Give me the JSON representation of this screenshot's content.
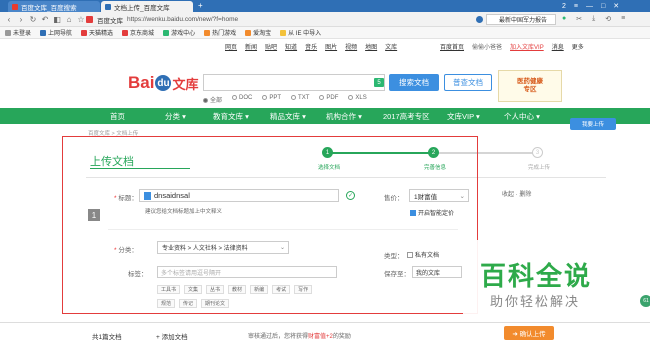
{
  "browser": {
    "tabs": [
      {
        "label": "百度文库_百度搜索",
        "active": false
      },
      {
        "label": "文档上传_百度文库",
        "active": true
      }
    ],
    "new_tab": "+",
    "window_controls": [
      "2",
      "≡",
      "—",
      "□",
      "✕"
    ],
    "url_prefix": "百度文库",
    "url": "https://wenku.baidu.com/new/?f=home",
    "right_search_text": "最新中国军力报告",
    "bookmarks": [
      {
        "label": "未登录",
        "color": "#999999"
      },
      {
        "label": "上网导航",
        "color": "#2f6fb5"
      },
      {
        "label": "天猫精选",
        "color": "#e33c3c"
      },
      {
        "label": "京东商城",
        "color": "#e33c3c"
      },
      {
        "label": "游戏中心",
        "color": "#2cb872"
      },
      {
        "label": "热门游戏",
        "color": "#f28b2d"
      },
      {
        "label": "爱淘宝",
        "color": "#f28b2d"
      },
      {
        "label": "从 IE 中导入",
        "color": "#f3c23b"
      }
    ]
  },
  "top_links": [
    "网页",
    "新闻",
    "贴吧",
    "知道",
    "音乐",
    "图片",
    "视频",
    "地图",
    "文库"
  ],
  "right_links": [
    "百度首页",
    "偷偷小爸爸",
    "加入文库VIP",
    "消息",
    "更多"
  ],
  "logo": {
    "bai": "Bai",
    "du": "du",
    "wenku": "文库"
  },
  "search": {
    "badge": "5",
    "search_button": "搜索文档",
    "vip_button": "普查文档",
    "filters": [
      {
        "label": "全部",
        "selected": true
      },
      {
        "label": "DOC",
        "selected": false
      },
      {
        "label": "PPT",
        "selected": false
      },
      {
        "label": "TXT",
        "selected": false
      },
      {
        "label": "PDF",
        "selected": false
      },
      {
        "label": "XLS",
        "selected": false
      }
    ]
  },
  "promo": {
    "line1": "医药健康",
    "line2": "专区"
  },
  "nav": {
    "items": [
      "首页",
      "分类 ▾",
      "教育文库 ▾",
      "精品文库 ▾",
      "机构合作 ▾",
      "2017高考专区",
      "文库VIP ▾",
      "个人中心 ▾"
    ],
    "upload_pill": "我要上传"
  },
  "breadcrumb": "百度文库 > 文档上传",
  "page_title": "上传文档",
  "steps": [
    {
      "num": "1",
      "label": "选择文档",
      "done": true
    },
    {
      "num": "2",
      "label": "完善信息",
      "done": true
    },
    {
      "num": "3",
      "label": "完成上传",
      "done": false
    }
  ],
  "form": {
    "doc_index": "1",
    "title_label": "标题：",
    "title_value": "dnsaidnsal",
    "title_hint": "建议您给文档标题加上中文释义",
    "price_label": "售价：",
    "price_value": "1财富值",
    "smart_price": "开启智能定价",
    "fold_text": "收起 · 删除",
    "category_label": "分类：",
    "category_value": "专业资料 > 人文社科 > 法律资料",
    "tags_label": "标签：",
    "tags_placeholder": "多个标签请用逗号隔开",
    "tag_chips_row1": [
      "工具书",
      "文集",
      "丛书",
      "教材",
      "新编",
      "考试",
      "写作"
    ],
    "tag_chips_row2": [
      "规范",
      "传记",
      "期刊论文"
    ],
    "type_label": "类型：",
    "private_label": "私有文档",
    "save_label": "保存至：",
    "save_value": "我的文库"
  },
  "watermark": {
    "title": "百科全说",
    "subtitle": "助你轻松解决"
  },
  "bottom": {
    "count": "共1篇文档",
    "add_button": "+ 添加文档",
    "notice_prefix": "审核通过后，您将获得",
    "notice_highlight": "财富值+2",
    "notice_suffix": "的奖励",
    "confirm_button": "➜ 确认上传"
  },
  "side_circle": "61"
}
